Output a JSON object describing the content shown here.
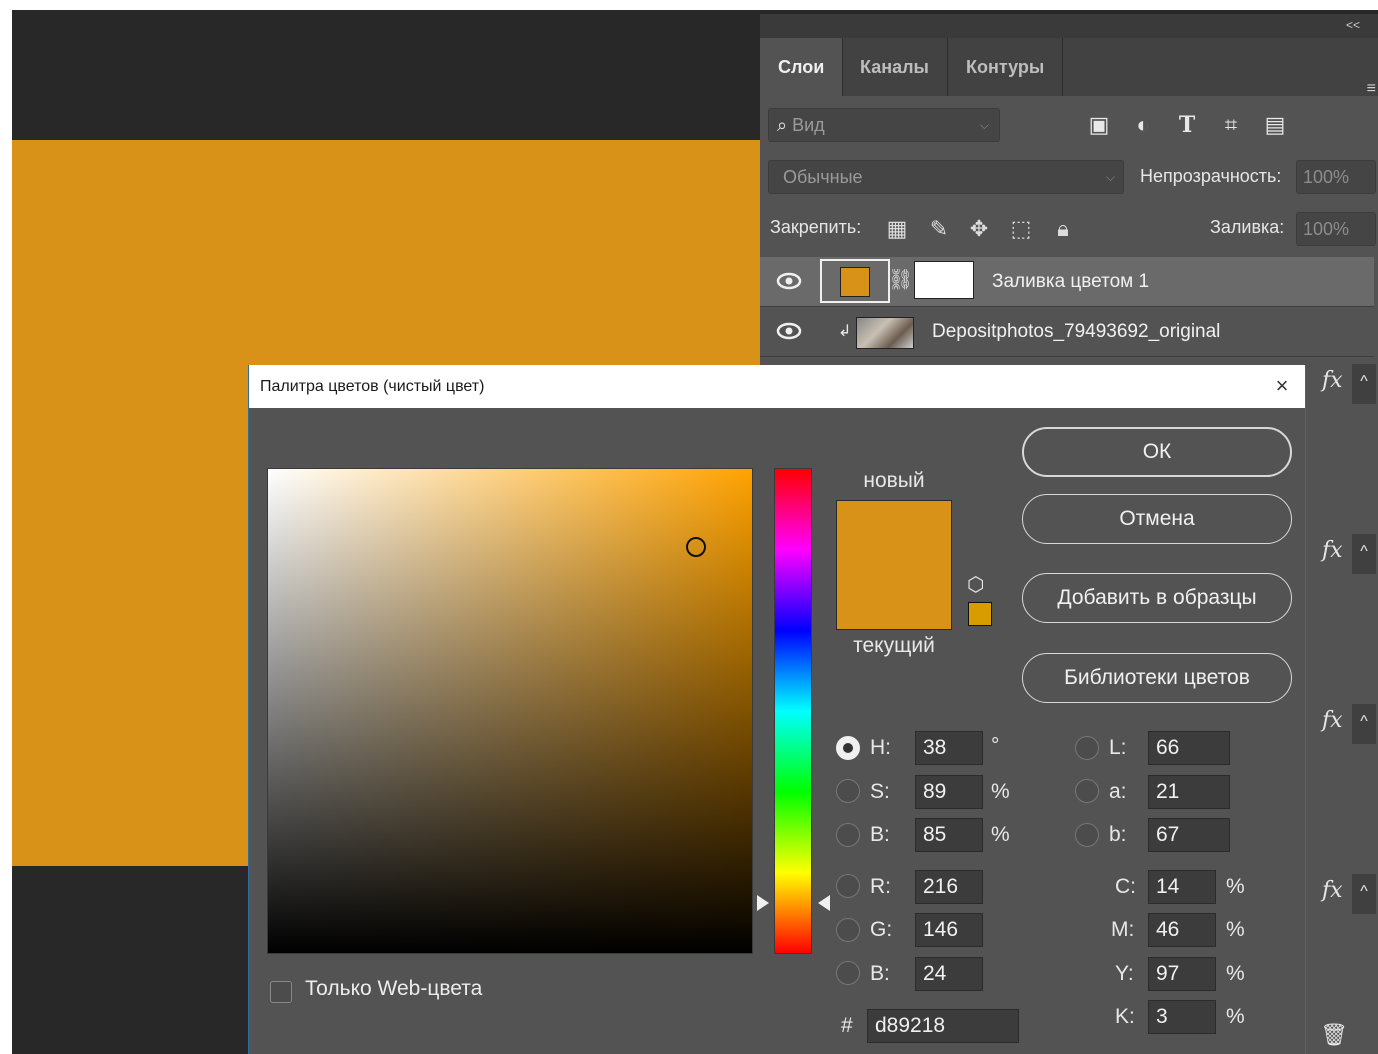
{
  "layers_panel": {
    "collapse": "<<",
    "tabs": [
      "Слои",
      "Каналы",
      "Контуры"
    ],
    "filter_placeholder": "Вид",
    "blend_mode": "Обычные",
    "opacity_label": "Непрозрачность:",
    "opacity_value": "100%",
    "lock_label": "Закрепить:",
    "fill_label": "Заливка:",
    "fill_value": "100%",
    "layers": [
      {
        "name": "Заливка цветом 1",
        "visible": true,
        "selected": true
      },
      {
        "name": "Depositphotos_79493692_original",
        "visible": true,
        "selected": false
      }
    ],
    "fx_label": "fx",
    "fx_toggle": "^"
  },
  "dialog": {
    "title": "Палитра цветов (чистый цвет)",
    "close": "×",
    "new_label": "новый",
    "current_label": "текущий",
    "buttons": {
      "ok": "ОК",
      "cancel": "Отмена",
      "add_to_swatches": "Добавить в образцы",
      "color_libraries": "Библиотеки цветов"
    },
    "hsb": {
      "h_label": "H:",
      "h": "38",
      "h_unit": "°",
      "s_label": "S:",
      "s": "89",
      "s_unit": "%",
      "b_label": "B:",
      "b": "85",
      "b_unit": "%"
    },
    "rgb": {
      "r_label": "R:",
      "r": "216",
      "g_label": "G:",
      "g": "146",
      "b_label": "B:",
      "b": "24"
    },
    "lab": {
      "l_label": "L:",
      "l": "66",
      "a_label": "a:",
      "a": "21",
      "b_label": "b:",
      "b": "67"
    },
    "cmyk": {
      "c_label": "C:",
      "c": "14",
      "m_label": "M:",
      "m": "46",
      "y_label": "Y:",
      "y": "97",
      "k_label": "K:",
      "k": "3",
      "unit": "%"
    },
    "hex_label": "#",
    "hex": "d89218",
    "web_only_label": "Только Web-цвета",
    "web_only_checked": false
  },
  "colors": {
    "fill": "#d89218",
    "web_safe": "#d89c00"
  }
}
